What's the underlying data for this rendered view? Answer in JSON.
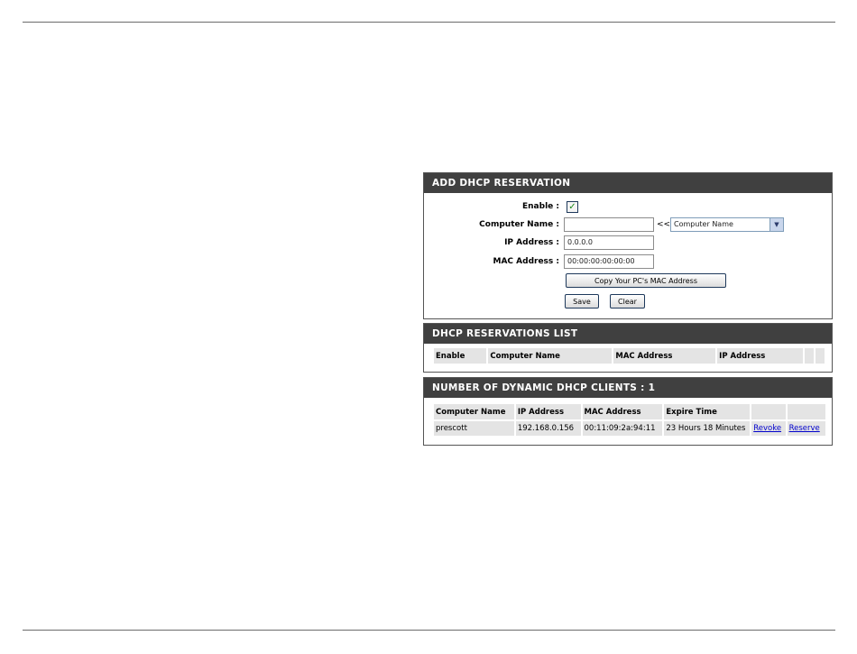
{
  "add_reservation": {
    "title": "ADD DHCP RESERVATION",
    "enable_label": "Enable :",
    "enable_mark": "✓",
    "computer_name_label": "Computer Name :",
    "computer_name_value": "",
    "computer_name_select_prefix": "<<",
    "computer_name_select": "Computer Name",
    "ip_label": "IP Address :",
    "ip_value": "0.0.0.0",
    "mac_label": "MAC Address :",
    "mac_value": "00:00:00:00:00:00",
    "copy_mac_button": "Copy Your PC's MAC Address",
    "save_button": "Save",
    "clear_button": "Clear"
  },
  "reservations_list": {
    "title": "DHCP RESERVATIONS LIST",
    "columns": [
      "Enable",
      "Computer Name",
      "MAC Address",
      "IP Address"
    ]
  },
  "dynamic_clients": {
    "title": "NUMBER OF DYNAMIC DHCP CLIENTS : 1",
    "columns": [
      "Computer Name",
      "IP Address",
      "MAC Address",
      "Expire Time"
    ],
    "rows": [
      {
        "computer_name": "prescott",
        "ip": "192.168.0.156",
        "mac": "00:11:09:2a:94:11",
        "expire": "23 Hours 18 Minutes",
        "revoke": "Revoke",
        "reserve": "Reserve"
      }
    ]
  }
}
